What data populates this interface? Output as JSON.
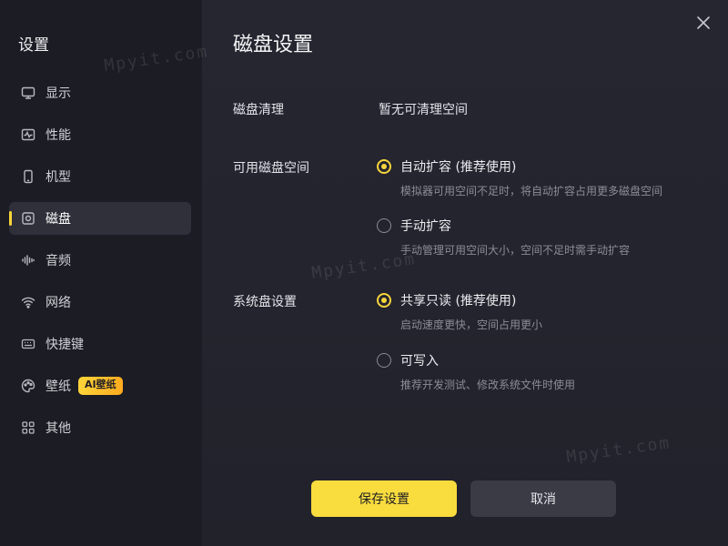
{
  "sidebar": {
    "title": "设置",
    "items": [
      {
        "label": "显示",
        "icon": "monitor-icon"
      },
      {
        "label": "性能",
        "icon": "pulse-icon"
      },
      {
        "label": "机型",
        "icon": "phone-icon"
      },
      {
        "label": "磁盘",
        "icon": "disk-icon",
        "active": true
      },
      {
        "label": "音频",
        "icon": "audio-wave-icon"
      },
      {
        "label": "网络",
        "icon": "wifi-icon"
      },
      {
        "label": "快捷键",
        "icon": "keyboard-icon"
      },
      {
        "label": "壁纸",
        "icon": "palette-icon",
        "badge": "AI壁纸"
      },
      {
        "label": "其他",
        "icon": "grid-icon"
      }
    ]
  },
  "main": {
    "title": "磁盘设置",
    "disk_cleanup": {
      "label": "磁盘清理",
      "value": "暂无可清理空间"
    },
    "available_space": {
      "label": "可用磁盘空间",
      "options": [
        {
          "label": "自动扩容 (推荐使用)",
          "desc": "模拟器可用空间不足时，将自动扩容占用更多磁盘空间",
          "checked": true
        },
        {
          "label": "手动扩容",
          "desc": "手动管理可用空间大小，空间不足时需手动扩容",
          "checked": false
        }
      ]
    },
    "system_disk": {
      "label": "系统盘设置",
      "options": [
        {
          "label": "共享只读 (推荐使用)",
          "desc": "启动速度更快，空间占用更小",
          "checked": true
        },
        {
          "label": "可写入",
          "desc": "推荐开发测试、修改系统文件时使用",
          "checked": false
        }
      ]
    }
  },
  "buttons": {
    "save": "保存设置",
    "cancel": "取消"
  },
  "watermark": "Mpyit.com",
  "colors": {
    "accent": "#f7d53b",
    "sidebar_bg": "#1c1c24",
    "main_bg": "#24242d"
  }
}
